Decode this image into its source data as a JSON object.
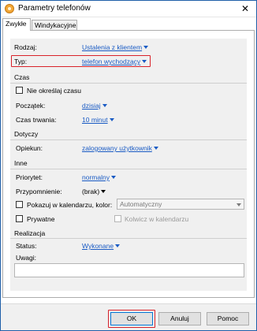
{
  "window": {
    "title": "Parametry telefonów",
    "close_glyph": "✕"
  },
  "tabs": [
    {
      "label": "Zwykłe",
      "active": true
    },
    {
      "label": "Windykacyjne",
      "active": false
    }
  ],
  "fields": {
    "rodzaj": {
      "label": "Rodzaj:",
      "value": "Ustalenia z klientem"
    },
    "typ": {
      "label": "Typ:",
      "value": "telefon wychodzący"
    }
  },
  "sections": {
    "czas": {
      "title": "Czas",
      "no_time_label": "Nie określaj czasu",
      "poczatek": {
        "label": "Początek:",
        "value": "dzisiaj"
      },
      "czas_trwania": {
        "label": "Czas trwania:",
        "value": "10 minut"
      }
    },
    "dotyczy": {
      "title": "Dotyczy",
      "opiekun": {
        "label": "Opiekun:",
        "value": "zalogowany użytkownik"
      }
    },
    "inne": {
      "title": "Inne",
      "priorytet": {
        "label": "Priorytet:",
        "value": "normalny"
      },
      "przypomnienie": {
        "label": "Przypomnienie:",
        "value": "(brak)"
      },
      "kalendarz": {
        "label": "Pokazuj w kalendarzu, kolor:",
        "color_value": "Automatyczny"
      },
      "prywatne_label": "Prywatne",
      "kolwicz_label": "Kolwicz w kalendarzu"
    },
    "realizacja": {
      "title": "Realizacja",
      "status": {
        "label": "Status:",
        "value": "Wykonane"
      },
      "uwagi": {
        "label": "Uwagi:",
        "value": ""
      }
    }
  },
  "buttons": {
    "ok": "OK",
    "cancel": "Anuluj",
    "help": "Pomoc"
  },
  "colors": {
    "link": "#1a5bc4",
    "highlight": "#d9222a",
    "accent": "#0078d7"
  },
  "icons": {
    "app": "phone-app-icon",
    "dropdown": "chevron-down-icon"
  }
}
